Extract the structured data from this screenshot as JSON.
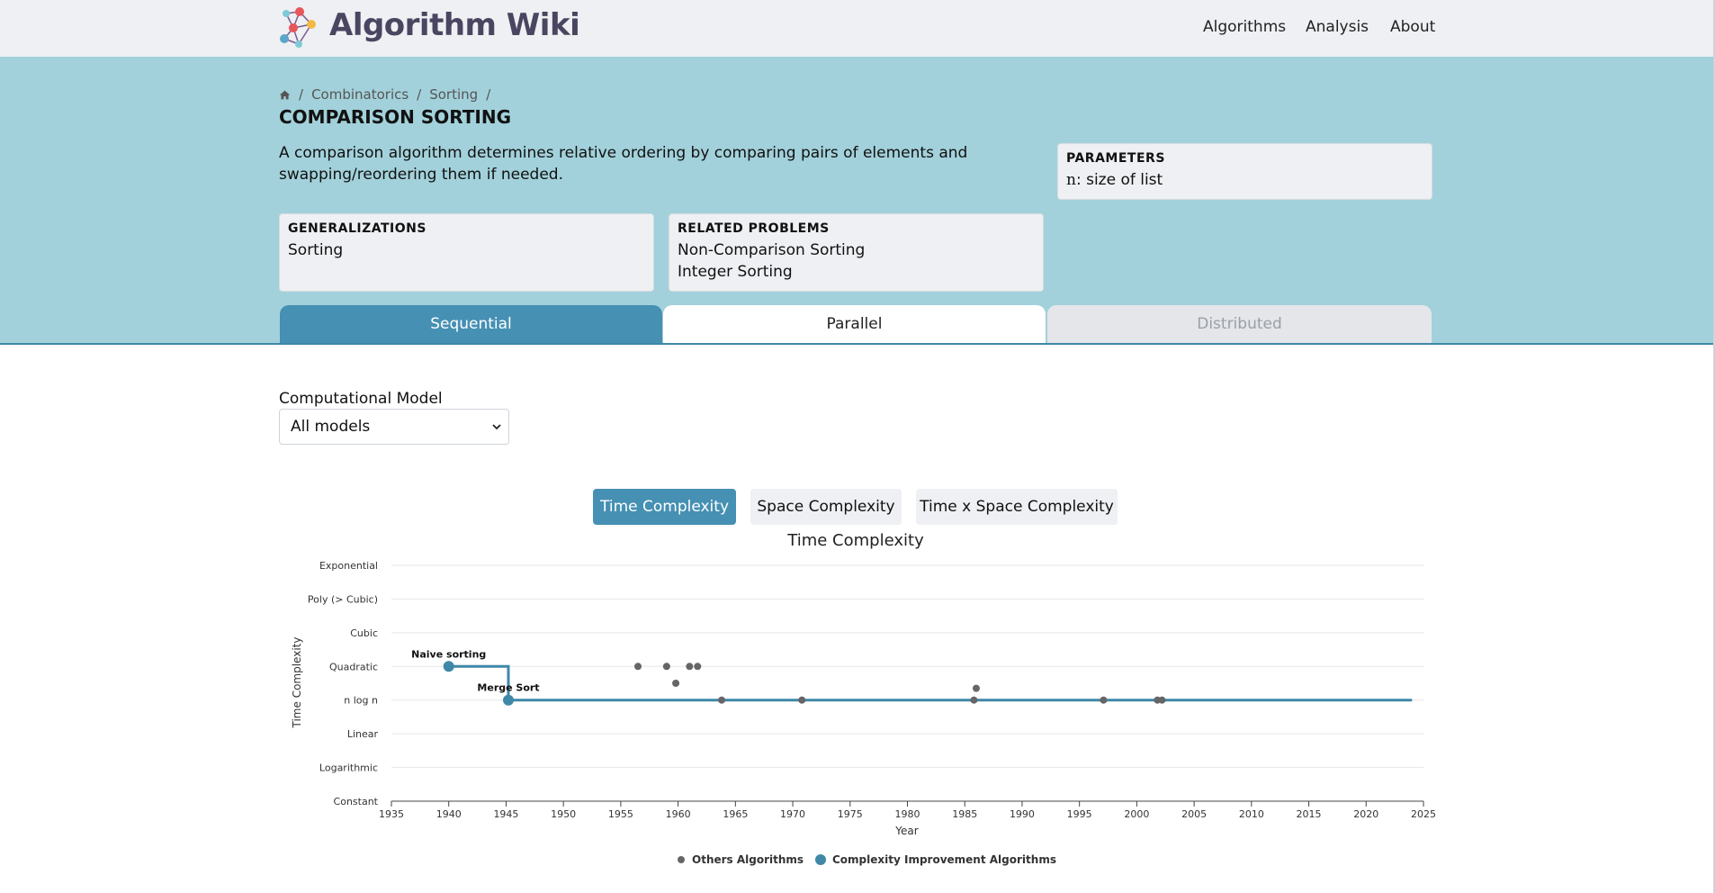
{
  "navbar": {
    "brand": "Algorithm Wiki",
    "links": [
      "Algorithms",
      "Analysis",
      "About"
    ]
  },
  "breadcrumb": {
    "home_icon": "home-icon",
    "items": [
      "Combinatorics",
      "Sorting"
    ],
    "separator": "/"
  },
  "problem": {
    "title": "COMPARISON SORTING",
    "description": "A comparison algorithm determines relative ordering by comparing pairs of elements and swapping/reordering them if needed."
  },
  "parameters": {
    "heading": "PARAMETERS",
    "items": [
      {
        "symbol": "n",
        "text": ": size of list"
      }
    ]
  },
  "generalizations": {
    "heading": "GENERALIZATIONS",
    "items": [
      "Sorting"
    ]
  },
  "related_problems": {
    "heading": "RELATED PROBLEMS",
    "items": [
      "Non-Comparison Sorting",
      "Integer Sorting"
    ]
  },
  "tabs": [
    {
      "label": "Sequential",
      "state": "active"
    },
    {
      "label": "Parallel",
      "state": "normal"
    },
    {
      "label": "Distributed",
      "state": "disabled"
    }
  ],
  "model_select": {
    "label": "Computational Model",
    "value": "All models"
  },
  "complexity_buttons": [
    {
      "label": "Time Complexity",
      "active": true
    },
    {
      "label": "Space Complexity",
      "active": false
    },
    {
      "label": "Time x Space Complexity",
      "active": false
    }
  ],
  "colors": {
    "accent": "#4590b3",
    "band": "#a2d1db",
    "others_dot": "#666666",
    "improvement": "#3f88a8"
  },
  "chart_data": {
    "type": "scatter",
    "title": "Time Complexity",
    "xlabel": "Year",
    "ylabel": "Time Complexity",
    "xlim": [
      1935,
      2025
    ],
    "x_ticks": [
      1935,
      1940,
      1945,
      1950,
      1955,
      1960,
      1965,
      1970,
      1975,
      1980,
      1985,
      1990,
      1995,
      2000,
      2005,
      2010,
      2015,
      2020,
      2025
    ],
    "y_categories": [
      "Constant",
      "Logarithmic",
      "Linear",
      "n log n",
      "Quadratic",
      "Cubic",
      "Poly (> Cubic)",
      "Exponential"
    ],
    "grid": true,
    "legend_position": "bottom-center",
    "series": [
      {
        "name": "Others Algorithms",
        "points": [
          {
            "x": 1956.5,
            "y": 4
          },
          {
            "x": 1959,
            "y": 4
          },
          {
            "x": 1961,
            "y": 4
          },
          {
            "x": 1961.7,
            "y": 4
          },
          {
            "x": 1959.8,
            "y": 3.5
          },
          {
            "x": 1963.8,
            "y": 3
          },
          {
            "x": 1970.8,
            "y": 3
          },
          {
            "x": 1986,
            "y": 3.35
          },
          {
            "x": 1985.8,
            "y": 3
          },
          {
            "x": 1997.1,
            "y": 3
          },
          {
            "x": 2001.8,
            "y": 3
          },
          {
            "x": 2002.2,
            "y": 3
          }
        ]
      },
      {
        "name": "Complexity Improvement Algorithms",
        "points": [
          {
            "x": 1940,
            "y": 4,
            "label": "Naive sorting"
          },
          {
            "x": 1945.2,
            "y": 3,
            "label": "Merge Sort"
          }
        ],
        "step_line_end": 2024
      }
    ]
  }
}
